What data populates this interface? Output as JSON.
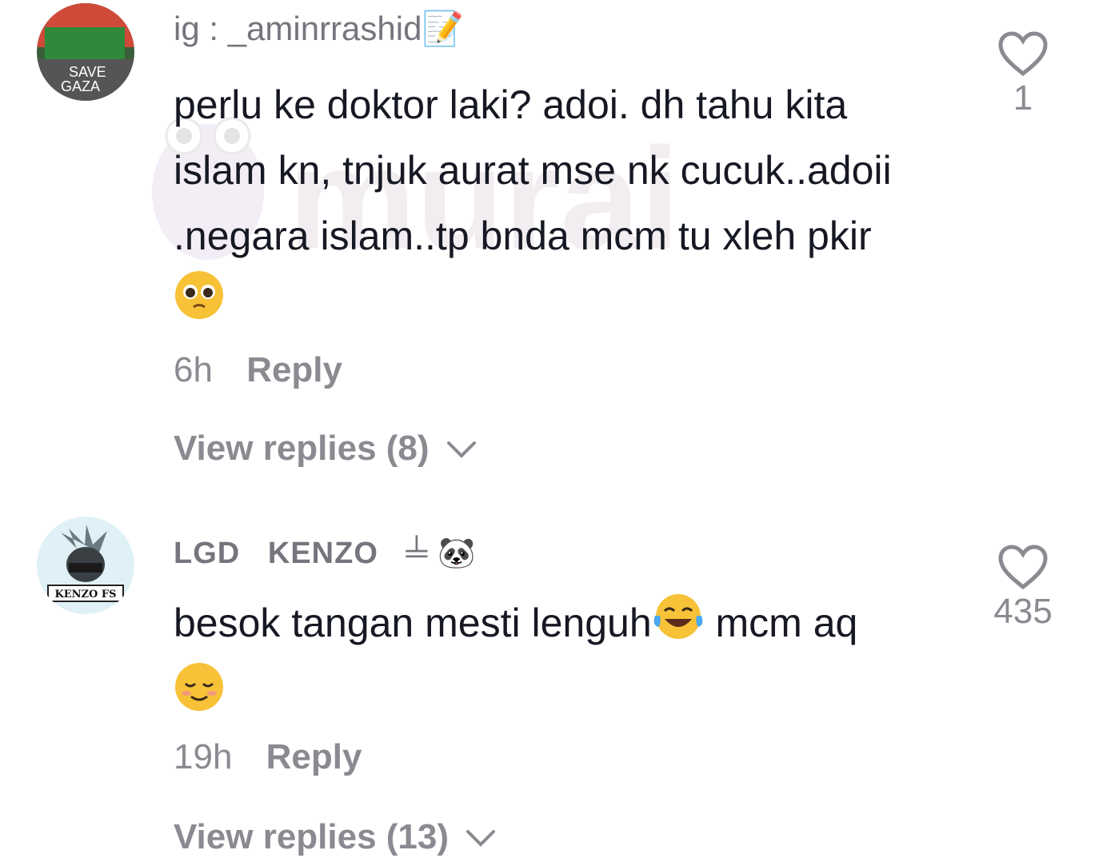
{
  "comments": [
    {
      "username": "ig : _aminrrashid📝",
      "avatar_text": [
        "SAVE",
        "GAZA"
      ],
      "text": "perlu ke doktor laki? adoi. dh tahu kita islam kn, tnjuk aurat mse nk cucuk..adoii .negara islam..tp bnda mcm tu xleh pkir",
      "time": "6h",
      "reply_label": "Reply",
      "view_replies": "View replies (8)",
      "likes": "1"
    },
    {
      "username": "LGD   KENZO   ╧ 🐼",
      "avatar_text": "KENZO FS",
      "text_before": "besok tangan mesti lenguh",
      "text_after": " mcm aq ",
      "time": "19h",
      "reply_label": "Reply",
      "view_replies": "View replies (13)",
      "likes": "435"
    }
  ],
  "watermark": "murai",
  "colors": {
    "text": "#161823",
    "muted": "#8a8b91",
    "username": "#75767d"
  }
}
